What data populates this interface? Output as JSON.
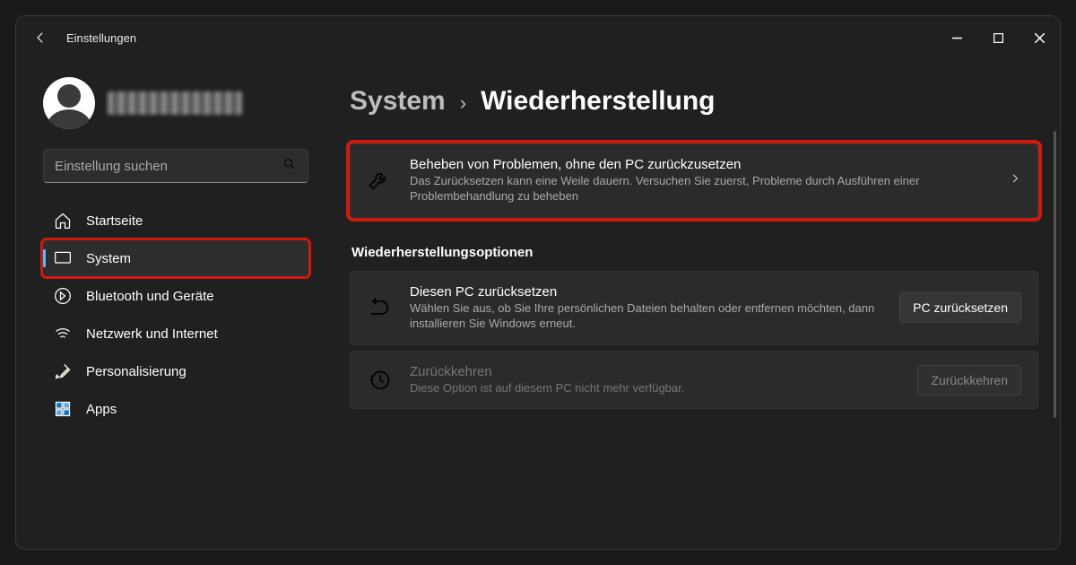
{
  "window": {
    "title": "Einstellungen"
  },
  "search": {
    "placeholder": "Einstellung suchen"
  },
  "sidebar": {
    "items": [
      {
        "label": "Startseite"
      },
      {
        "label": "System"
      },
      {
        "label": "Bluetooth und Geräte"
      },
      {
        "label": "Netzwerk und Internet"
      },
      {
        "label": "Personalisierung"
      },
      {
        "label": "Apps"
      }
    ]
  },
  "breadcrumb": {
    "parent": "System",
    "current": "Wiederherstellung"
  },
  "cards": {
    "troubleshoot": {
      "title": "Beheben von Problemen, ohne den PC zurückzusetzen",
      "desc": "Das Zurücksetzen kann eine Weile dauern. Versuchen Sie zuerst, Probleme durch Ausführen einer Problembehandlung zu beheben"
    },
    "section_title": "Wiederherstellungsoptionen",
    "reset": {
      "title": "Diesen PC zurücksetzen",
      "desc": "Wählen Sie aus, ob Sie Ihre persönlichen Dateien behalten oder entfernen möchten, dann installieren Sie Windows erneut.",
      "button": "PC zurücksetzen"
    },
    "goback": {
      "title": "Zurückkehren",
      "desc": "Diese Option ist auf diesem PC nicht mehr verfügbar.",
      "button": "Zurückkehren"
    }
  }
}
